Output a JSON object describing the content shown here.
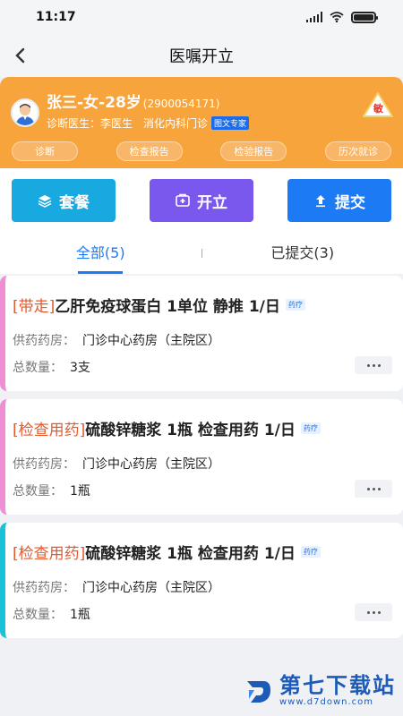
{
  "status_bar": {
    "time": "11:17"
  },
  "nav": {
    "title": "医嘱开立"
  },
  "patient": {
    "name": "张三-女-28岁",
    "id": "(2900054171)",
    "doctor_label": "诊断医生：",
    "doctor_name": "李医生",
    "department": "消化内科门诊",
    "expert_badge": "图文专家",
    "allergy_label": "敏"
  },
  "quick_tabs": [
    "诊断",
    "检查报告",
    "检验报告",
    "历次就诊"
  ],
  "actions": {
    "package": "套餐",
    "create": "开立",
    "submit": "提交"
  },
  "filter_tabs": {
    "all": "全部(5)",
    "submitted": "已提交(3)"
  },
  "orders": [
    {
      "tag": "[带走]",
      "title": "乙肝免疫球蛋白  1单位  静推  1/日",
      "badge": "药疗",
      "pharmacy_label": "供药药房：",
      "pharmacy": "门诊中心药房（主院区）",
      "qty_label": "总数量：",
      "qty": "3支",
      "accent": "#f08ed5"
    },
    {
      "tag": "[检查用药]",
      "title": "硫酸锌糖浆 1瓶 检查用药 1/日",
      "badge": "药疗",
      "pharmacy_label": "供药药房：",
      "pharmacy": "门诊中心药房（主院区）",
      "qty_label": "总数量：",
      "qty": "1瓶",
      "accent": "#f08ed5"
    },
    {
      "tag": "[检查用药]",
      "title": "硫酸锌糖浆 1瓶 检查用药 1/日",
      "badge": "药疗",
      "pharmacy_label": "供药药房：",
      "pharmacy": "门诊中心药房（主院区）",
      "qty_label": "总数量：",
      "qty": "1瓶",
      "accent": "#18c2d7"
    }
  ],
  "watermark": {
    "name": "第七下载站",
    "url": "www.d7down.com"
  },
  "colors": {
    "header_orange": "#f7a43c",
    "primary_blue": "#1b7af4",
    "package_cyan": "#18a9e0",
    "create_purple": "#7b58ed",
    "tag_orange": "#e8582a"
  }
}
